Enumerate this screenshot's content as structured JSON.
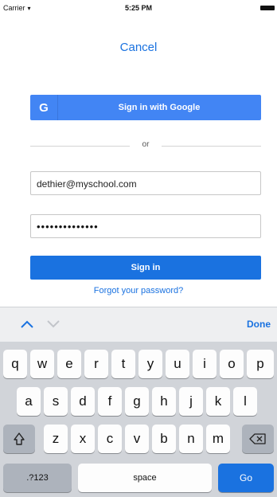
{
  "status_bar": {
    "carrier": "Carrier",
    "time": "5:25 PM"
  },
  "cancel_label": "Cancel",
  "google_button": {
    "icon_letter": "G",
    "label": "Sign in with Google"
  },
  "divider_text": "or",
  "email_field": {
    "value": "dethier@myschool.com"
  },
  "password_field": {
    "value": "••••••••••••••"
  },
  "signin_label": "Sign in",
  "forgot_label": "Forgot your password?",
  "toolbar": {
    "done_label": "Done"
  },
  "keyboard": {
    "row1": [
      "q",
      "w",
      "e",
      "r",
      "t",
      "y",
      "u",
      "i",
      "o",
      "p"
    ],
    "row2": [
      "a",
      "s",
      "d",
      "f",
      "g",
      "h",
      "j",
      "k",
      "l"
    ],
    "row3": [
      "z",
      "x",
      "c",
      "v",
      "b",
      "n",
      "m"
    ],
    "numbers_label": ".?123",
    "space_label": "space",
    "go_label": "Go",
    "icons": [
      "shift-icon",
      "backspace-icon",
      "wifi-icon",
      "battery-icon",
      "chevron-up-icon",
      "chevron-down-icon"
    ]
  },
  "colors": {
    "accent": "#1a72e0",
    "google_blue": "#4285f4",
    "keyboard_bg": "#d1d4d9"
  }
}
